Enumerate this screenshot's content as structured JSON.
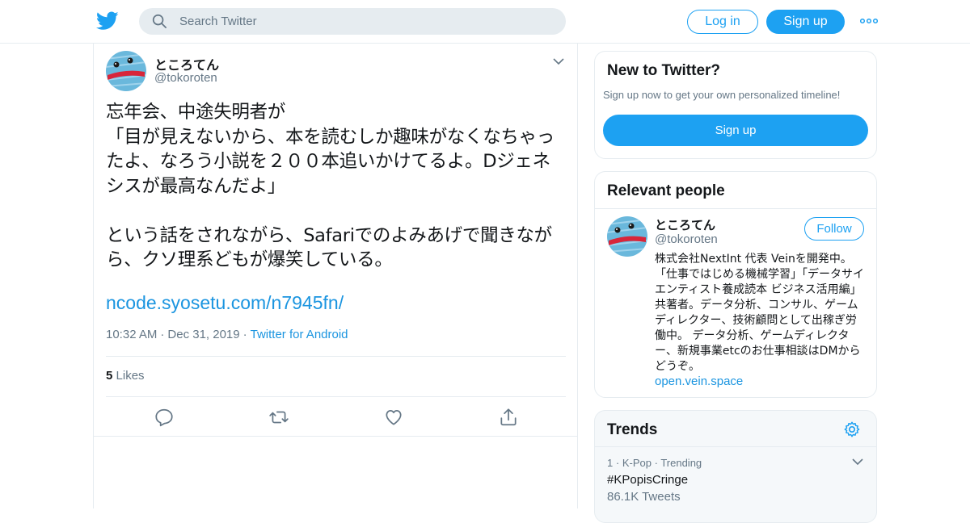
{
  "header": {
    "search_placeholder": "Search Twitter",
    "login_label": "Log in",
    "signup_label": "Sign up"
  },
  "tweet": {
    "author_name": "ところてん",
    "author_handle": "@tokoroten",
    "text": "忘年会、中途失明者が\n「目が見えないから、本を読むしか趣味がなくなちゃったよ、なろう小説を２００本追いかけてるよ。Dジェネシスが最高なんだよ」\n\nという話をされながら、Safariでのよみあげで聞きながら、クソ理系どもが爆笑している。",
    "link": "ncode.syosetu.com/n7945fn/",
    "time": "10:32 AM",
    "date": "Dec 31, 2019",
    "source": "Twitter for Android",
    "likes_count": "5",
    "likes_label": "Likes",
    "sep": "·"
  },
  "new_to_twitter": {
    "title": "New to Twitter?",
    "subtitle": "Sign up now to get your own personalized timeline!",
    "button": "Sign up"
  },
  "relevant_people": {
    "title": "Relevant people",
    "name": "ところてん",
    "handle": "@tokoroten",
    "follow_label": "Follow",
    "bio": "株式会社NextInt 代表 Veinを開発中。「仕事ではじめる機械学習」「データサイエンティスト養成読本 ビジネス活用編」共著者。データ分析、コンサル、ゲームディレクター、技術顧問として出稼ぎ労働中。 データ分析、ゲームディレクター、新規事業etcのお仕事相談はDMからどうぞ。",
    "link": "open.vein.space"
  },
  "trends": {
    "title": "Trends",
    "items": [
      {
        "rank": "1",
        "sep": "·",
        "category": "K-Pop",
        "status": "Trending",
        "name": "#KPopisCringe",
        "count": "86.1K Tweets"
      }
    ]
  },
  "colors": {
    "brand": "#1da1f2",
    "link": "#1b95e0",
    "muted": "#657786",
    "border": "#e6ecf0"
  },
  "icons": [
    "twitter-bird-icon",
    "search-icon",
    "more-dots-icon",
    "chevron-down-icon",
    "reply-icon",
    "retweet-icon",
    "like-icon",
    "share-icon",
    "gear-icon"
  ]
}
